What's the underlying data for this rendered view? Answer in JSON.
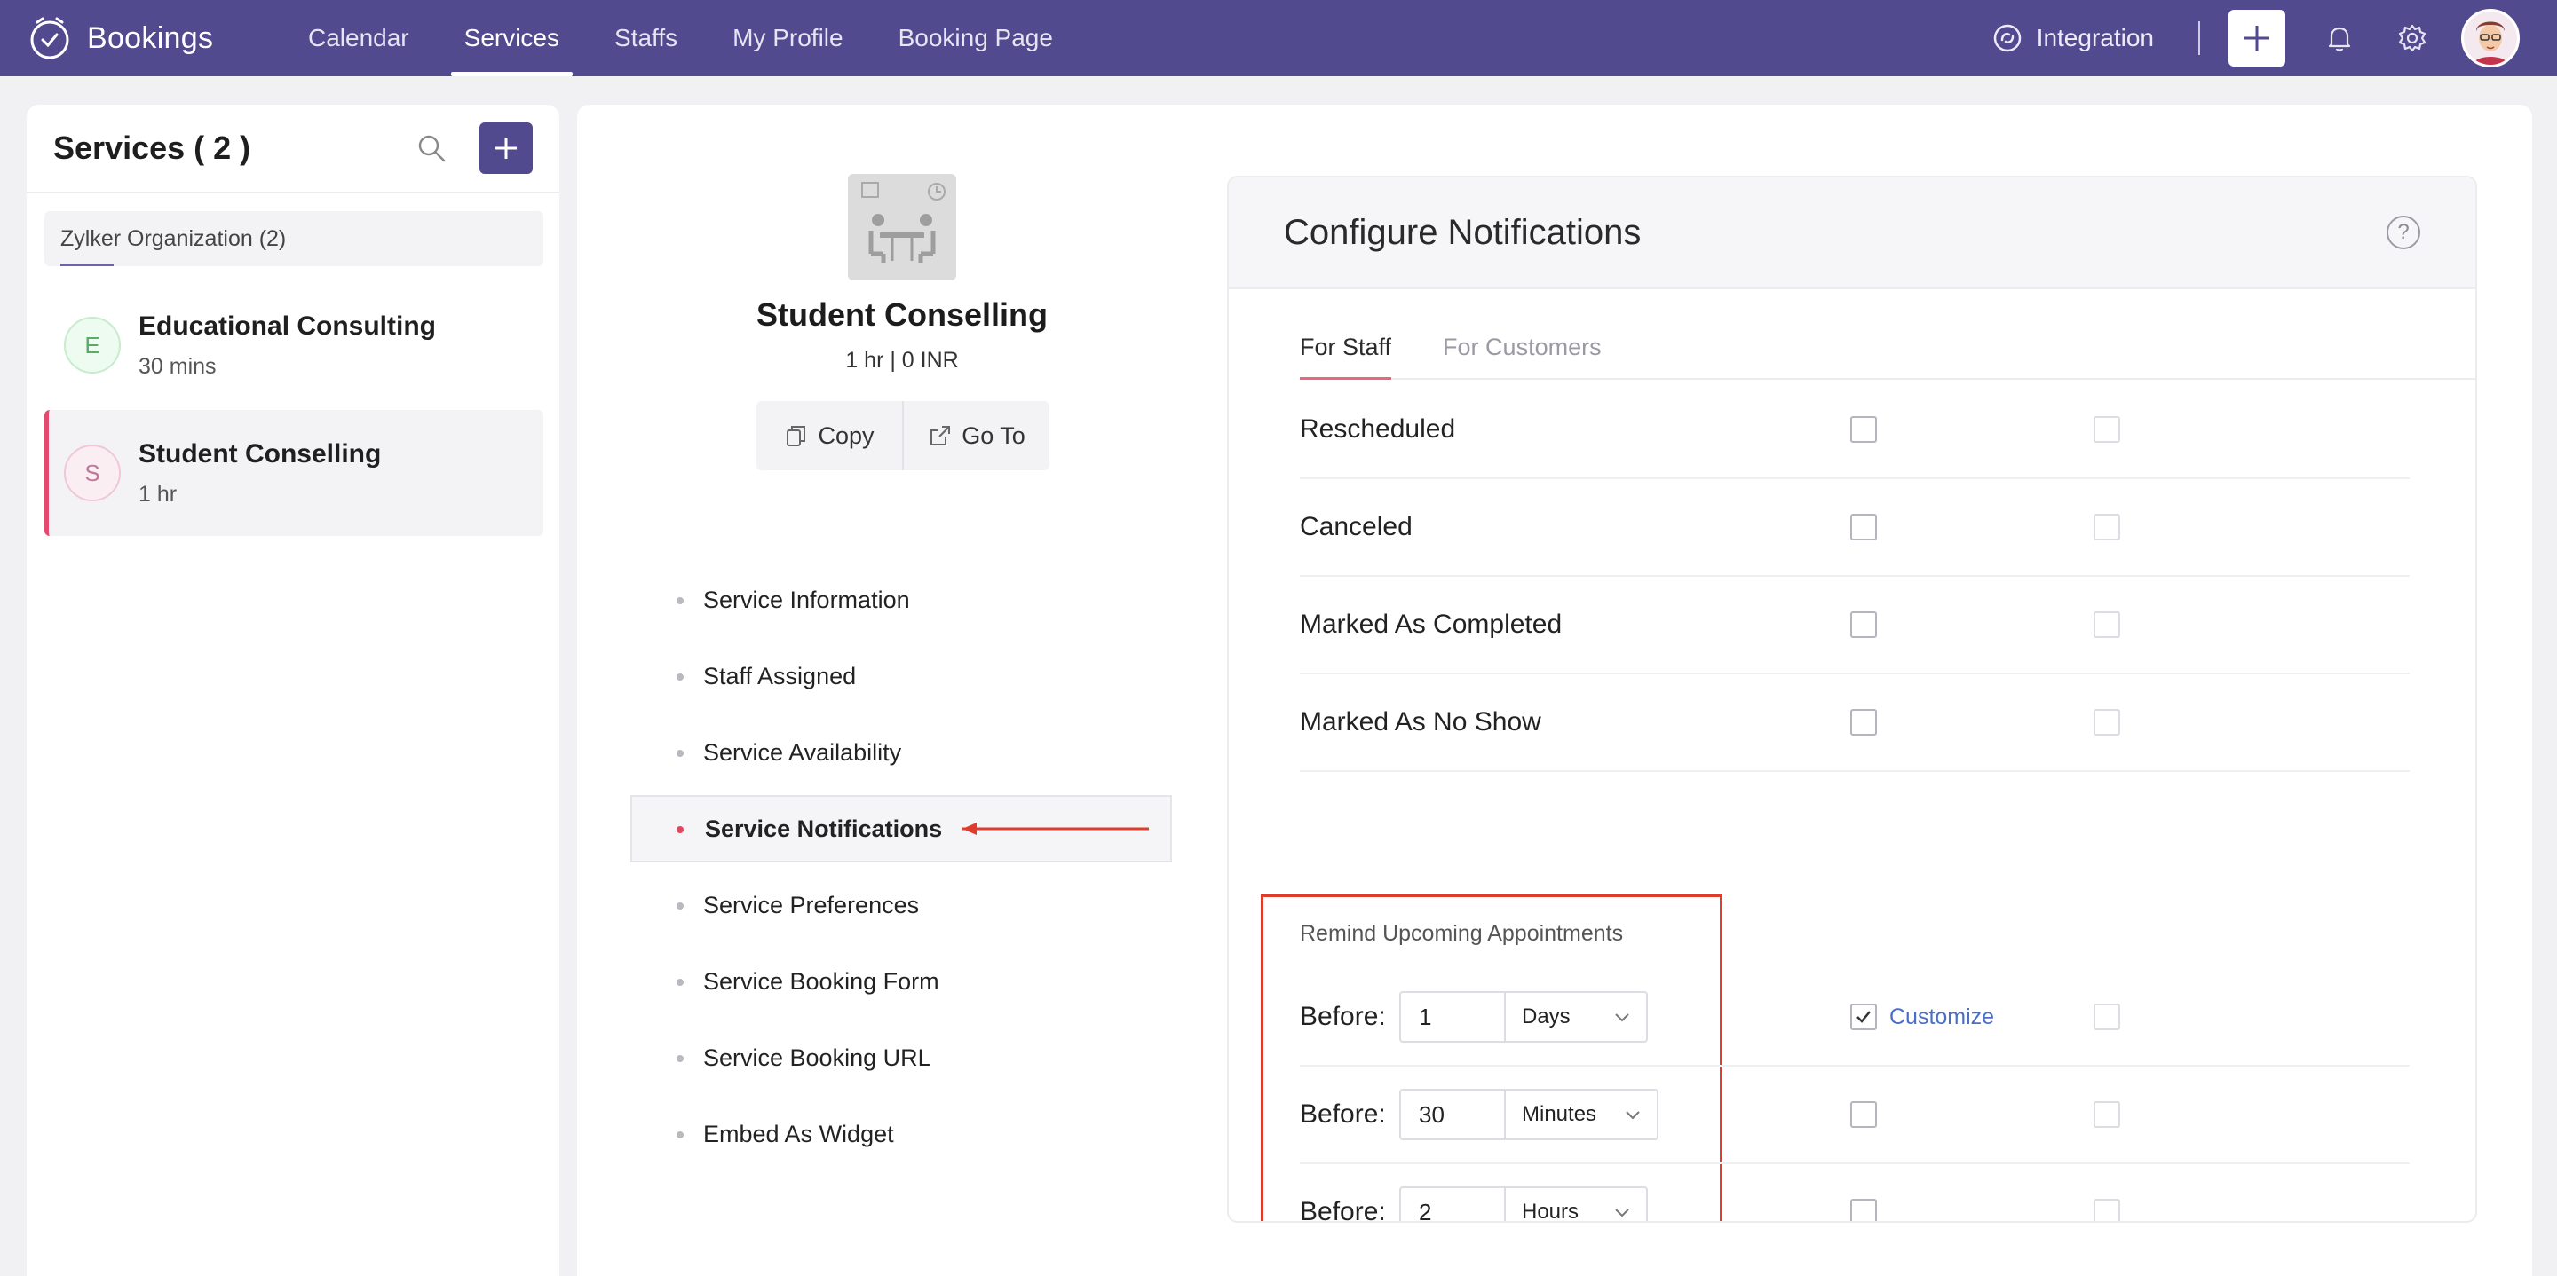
{
  "app": {
    "name": "Bookings"
  },
  "nav": {
    "items": [
      {
        "label": "Calendar"
      },
      {
        "label": "Services"
      },
      {
        "label": "Staffs"
      },
      {
        "label": "My Profile"
      },
      {
        "label": "Booking Page"
      }
    ],
    "active": "Services",
    "integration_label": "Integration"
  },
  "colors": {
    "header_bg": "#524a8e",
    "accent_red": "#e0475f",
    "link_blue": "#4a6fc7",
    "highlight_box": "#e03c2c"
  },
  "sidebar": {
    "title": "Services ( 2 )",
    "org_filter": "Zylker Organization (2)",
    "services": [
      {
        "initial": "E",
        "name": "Educational Consulting",
        "duration": "30 mins"
      },
      {
        "initial": "S",
        "name": "Student Conselling",
        "duration": "1 hr"
      }
    ]
  },
  "service": {
    "title": "Student Conselling",
    "meta": "1 hr | 0 INR",
    "copy_label": "Copy",
    "goto_label": "Go To",
    "menu": [
      {
        "label": "Service Information"
      },
      {
        "label": "Staff Assigned"
      },
      {
        "label": "Service Availability"
      },
      {
        "label": "Service Notifications"
      },
      {
        "label": "Service Preferences"
      },
      {
        "label": "Service Booking Form"
      },
      {
        "label": "Service Booking URL"
      },
      {
        "label": "Embed As Widget"
      }
    ],
    "active_menu": "Service Notifications"
  },
  "notifications": {
    "title": "Configure Notifications",
    "help_glyph": "?",
    "tabs": [
      {
        "label": "For Staff"
      },
      {
        "label": "For Customers"
      }
    ],
    "active_tab": "For Staff",
    "events": [
      {
        "label": "Rescheduled",
        "checked": false
      },
      {
        "label": "Canceled",
        "checked": false
      },
      {
        "label": "Marked As Completed",
        "checked": false
      },
      {
        "label": "Marked As No Show",
        "checked": false
      }
    ],
    "reminders": {
      "title": "Remind Upcoming Appointments",
      "before_label": "Before:",
      "customize_label": "Customize",
      "rows": [
        {
          "value": "1",
          "unit": "Days",
          "checked": true
        },
        {
          "value": "30",
          "unit": "Minutes",
          "checked": false
        },
        {
          "value": "2",
          "unit": "Hours",
          "checked": false
        }
      ]
    }
  }
}
